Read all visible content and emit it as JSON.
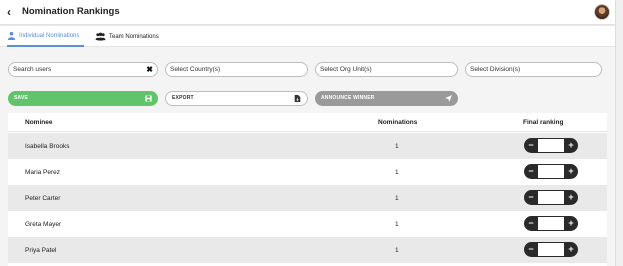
{
  "header": {
    "title": "Nomination Rankings",
    "back_icon": "back-arrow-icon"
  },
  "tabs": [
    {
      "label": "Individual Nominations",
      "icon": "person-icon",
      "active": true,
      "color": "#5b8fd6"
    },
    {
      "label": "Team Nominations",
      "icon": "team-icon",
      "active": false
    }
  ],
  "filters": {
    "search": "Search users",
    "country": "Select Country(s)",
    "org_unit": "Select Org Unit(s)",
    "division": "Select Division(s)"
  },
  "actions": {
    "save": "SAVE",
    "export": "EXPORT",
    "announce": "ANNOUNCE WINNER",
    "save_color": "#62c46a",
    "announce_color": "#9a9a9a"
  },
  "table": {
    "columns": [
      "Nominee",
      "Nominations",
      "Final ranking"
    ],
    "rows": [
      {
        "nominee": "Isabella Brooks",
        "nominations": "1"
      },
      {
        "nominee": "Maria Perez",
        "nominations": "1"
      },
      {
        "nominee": "Peter Carter",
        "nominations": "1"
      },
      {
        "nominee": "Greta Mayer",
        "nominations": "1"
      },
      {
        "nominee": "Priya Patel",
        "nominations": "1"
      }
    ]
  }
}
